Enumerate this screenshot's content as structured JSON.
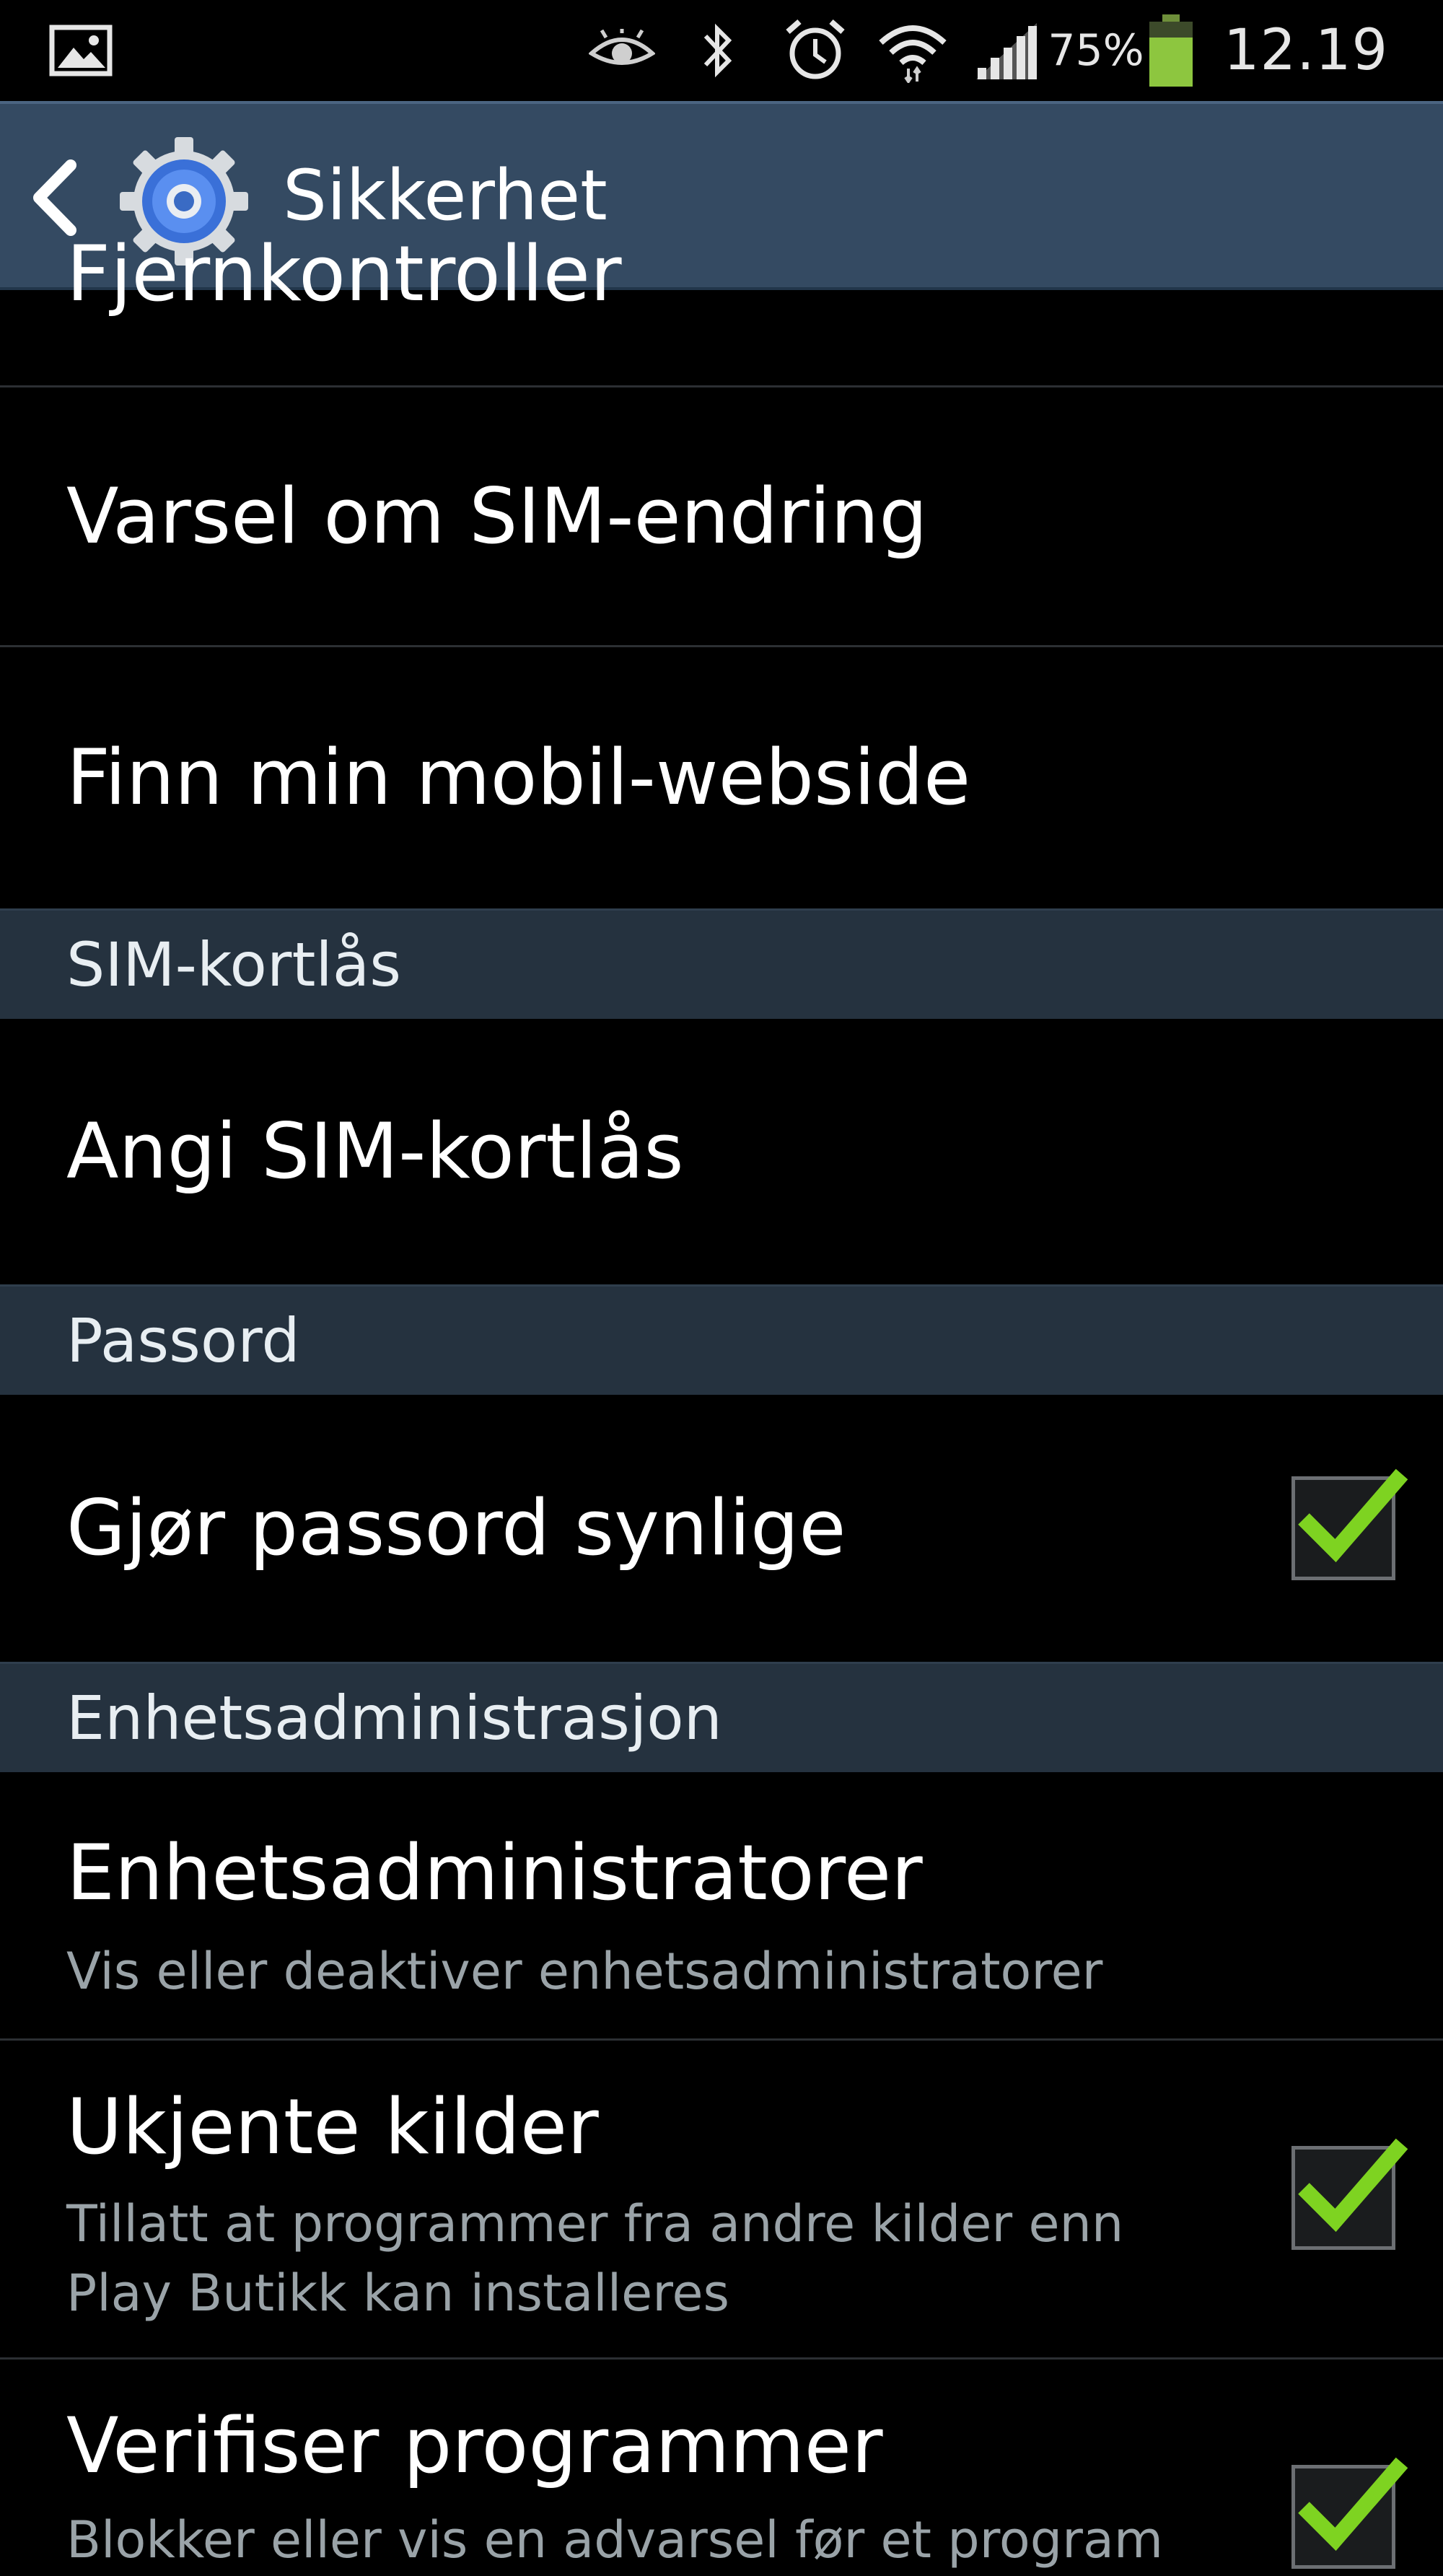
{
  "status_bar": {
    "battery_percent": "75%",
    "time": "12.19",
    "icons": [
      "gallery-icon",
      "eye-icon",
      "bluetooth-icon",
      "alarm-icon",
      "wifi-icon",
      "signal-icon",
      "battery-icon"
    ],
    "battery_color": "#8dc63f"
  },
  "action_bar": {
    "title": "Sikkerhet",
    "bar_color": "#344a62"
  },
  "list": {
    "partial_item": "Fjernkontroller",
    "sim_change_alert": "Varsel om SIM-endring",
    "find_my_mobile": "Finn min mobil-webside",
    "section_sim": "SIM-kortlås",
    "set_sim_lock": "Angi SIM-kortlås",
    "section_password": "Passord",
    "show_passwords": {
      "title": "Gjør passord synlige",
      "checked": true
    },
    "section_device_admin": "Enhetsadministrasjon",
    "device_admins": {
      "title": "Enhetsadministratorer",
      "subtitle": "Vis eller deaktiver enhetsadministratorer"
    },
    "unknown_sources": {
      "title": "Ukjente kilder",
      "subtitle_line1": "Tillatt at programmer fra andre kilder enn",
      "subtitle_line2": "Play Butikk kan installeres",
      "checked": true
    },
    "verify_apps": {
      "title": "Verifiser programmer",
      "subtitle_line1": "Blokker eller vis en advarsel før et program",
      "checked": true
    }
  },
  "colors": {
    "check_green": "#7ed321",
    "header_bg": "#25323f"
  }
}
